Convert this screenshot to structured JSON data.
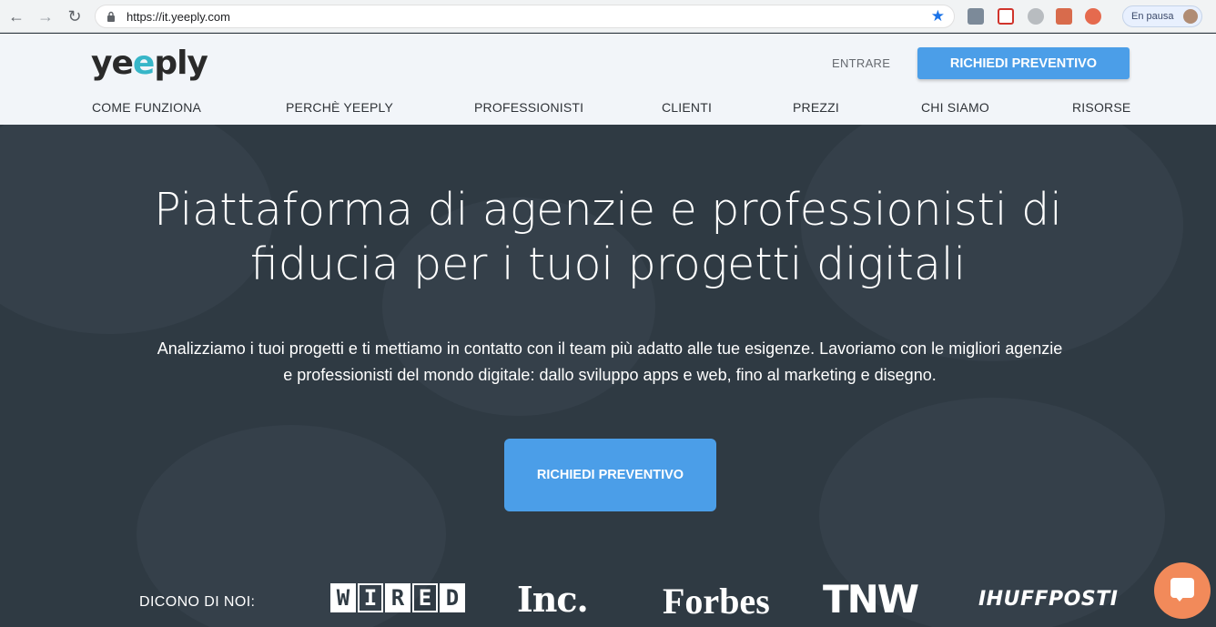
{
  "browser": {
    "url": "https://it.yeeply.com",
    "profile_label": "En pausa",
    "icons": [
      "back-icon",
      "forward-icon",
      "reload-icon",
      "lock-icon",
      "bookmark-star-icon"
    ]
  },
  "header": {
    "logo_text_a": "ye",
    "logo_text_b": "e",
    "logo_text_c": "ply",
    "login_label": "ENTRARE",
    "cta_label": "RICHIEDI PREVENTIVO",
    "nav": [
      "COME FUNZIONA",
      "PERCHÈ YEEPLY",
      "PROFESSIONISTI",
      "CLIENTI",
      "PREZZI",
      "CHI SIAMO",
      "RISORSE"
    ]
  },
  "hero": {
    "title_line1": "Piattaforma di agenzie e professionisti di",
    "title_line2": "fiducia per i tuoi progetti digitali",
    "subtitle_line1": "Analizziamo i tuoi progetti e ti mettiamo in contatto con il team più adatto alle tue esigenze. Lavoriamo con le migliori agenzie",
    "subtitle_line2": "e professionisti del mondo digitale: dallo sviluppo apps e web, fino al marketing e disegno.",
    "cta_label": "RICHIEDI PREVENTIVO"
  },
  "press": {
    "label": "DICONO DI NOI:",
    "wired": [
      "W",
      "I",
      "R",
      "E",
      "D"
    ],
    "inc": "Inc.",
    "forbes": "Forbes",
    "tnw": "TNW",
    "huffpost": "IHUFFPOSTI"
  },
  "colors": {
    "accent": "#4b9ee8",
    "logo_accent": "#37b6c8",
    "hero_bg": "#2f3a43",
    "chat": "#f28a5a"
  }
}
